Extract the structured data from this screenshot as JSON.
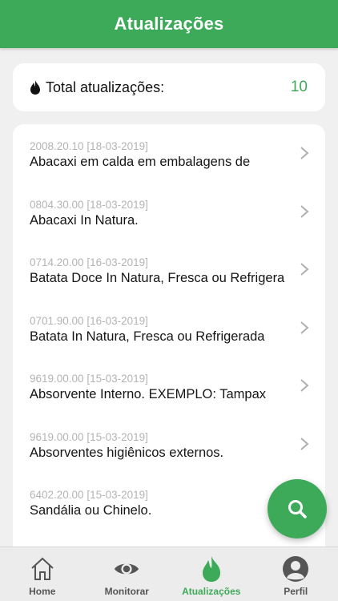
{
  "header": {
    "title": "Atualizações"
  },
  "total": {
    "label": "Total atualizações:",
    "value": "10",
    "icon": "drop-icon"
  },
  "updates": [
    {
      "code": "2008.20.10 [18-03-2019]",
      "description": "Abacaxi em calda em embalagens de"
    },
    {
      "code": "0804.30.00 [18-03-2019]",
      "description": "Abacaxi In Natura."
    },
    {
      "code": "0714.20.00 [16-03-2019]",
      "description": "Batata Doce In Natura, Fresca ou Refrigerada"
    },
    {
      "code": "0701.90.00 [16-03-2019]",
      "description": "Batata In Natura, Fresca ou Refrigerada"
    },
    {
      "code": "9619.00.00 [15-03-2019]",
      "description": "Absorvente Interno. EXEMPLO: Tampax"
    },
    {
      "code": "9619.00.00 [15-03-2019]",
      "description": "Absorventes higiênicos externos."
    },
    {
      "code": "6402.20.00 [15-03-2019]",
      "description": "Sandália ou Chinelo."
    }
  ],
  "fab": {
    "icon": "search-icon"
  },
  "tabs": [
    {
      "label": "Home",
      "icon": "home-icon",
      "active": false
    },
    {
      "label": "Monitorar",
      "icon": "eye-icon",
      "active": false
    },
    {
      "label": "Atualizações",
      "icon": "flame-icon",
      "active": true
    },
    {
      "label": "Perfil",
      "icon": "user-icon",
      "active": false
    }
  ],
  "colors": {
    "accent": "#3daa59",
    "background": "#f0f0f0"
  }
}
